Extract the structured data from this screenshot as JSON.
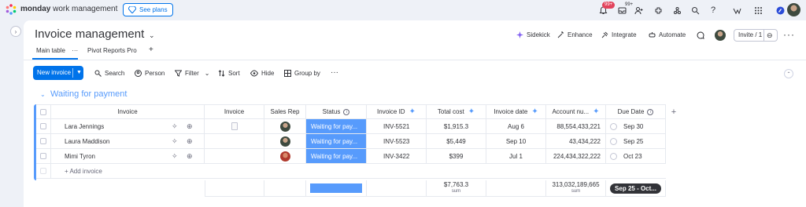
{
  "topbar": {
    "brand_bold": "monday",
    "brand_rest": " work management",
    "see_plans": "See plans",
    "notif_badge": "99+",
    "inbox_badge": "99+",
    "logo_colors": [
      "#f62b54",
      "#ffcb00",
      "#00ca72",
      "#579bfc",
      "#a25ddc",
      "#ff7575"
    ]
  },
  "board": {
    "title": "Invoice management",
    "actions": {
      "sidekick": "Sidekick",
      "enhance": "Enhance",
      "integrate": "Integrate",
      "automate": "Automate",
      "invite": "Invite / 1"
    },
    "views": {
      "main": "Main table",
      "pivot": "Pivot Reports Pro"
    }
  },
  "toolbar": {
    "new_item": "New invoice",
    "search": "Search",
    "person": "Person",
    "filter": "Filter",
    "sort": "Sort",
    "hide": "Hide",
    "group_by": "Group by"
  },
  "group": {
    "title": "Waiting for payment",
    "color": "#579bfc",
    "columns": {
      "invoice_name": "Invoice",
      "invoice_file": "Invoice",
      "sales_rep": "Sales Rep",
      "status": "Status",
      "invoice_id": "Invoice ID",
      "total_cost": "Total cost",
      "invoice_date": "Invoice date",
      "account_num": "Account nu...",
      "due_date": "Due Date"
    },
    "rows": [
      {
        "name": "Lara Jennings",
        "status": "Waiting for pay...",
        "invoice_id": "INV-5521",
        "total_cost": "$1,915.3",
        "invoice_date": "Aug 6",
        "account": "88,554,433,221",
        "due_date": "Sep 30"
      },
      {
        "name": "Laura Maddison",
        "status": "Waiting for pay...",
        "invoice_id": "INV-5523",
        "total_cost": "$5,449",
        "invoice_date": "Sep 10",
        "account": "43,434,222",
        "due_date": "Sep 25"
      },
      {
        "name": "Mimi Tyron",
        "status": "Waiting for pay...",
        "invoice_id": "INV-3422",
        "total_cost": "$399",
        "invoice_date": "Jul 1",
        "account": "224,434,322,222",
        "due_date": "Oct 23"
      }
    ],
    "add_item": "+ Add invoice",
    "summary": {
      "total_cost": "$7,763.3",
      "total_cost_label": "sum",
      "account": "313,032,189,665",
      "account_label": "sum",
      "due_range": "Sep 25 - Oct..."
    }
  }
}
